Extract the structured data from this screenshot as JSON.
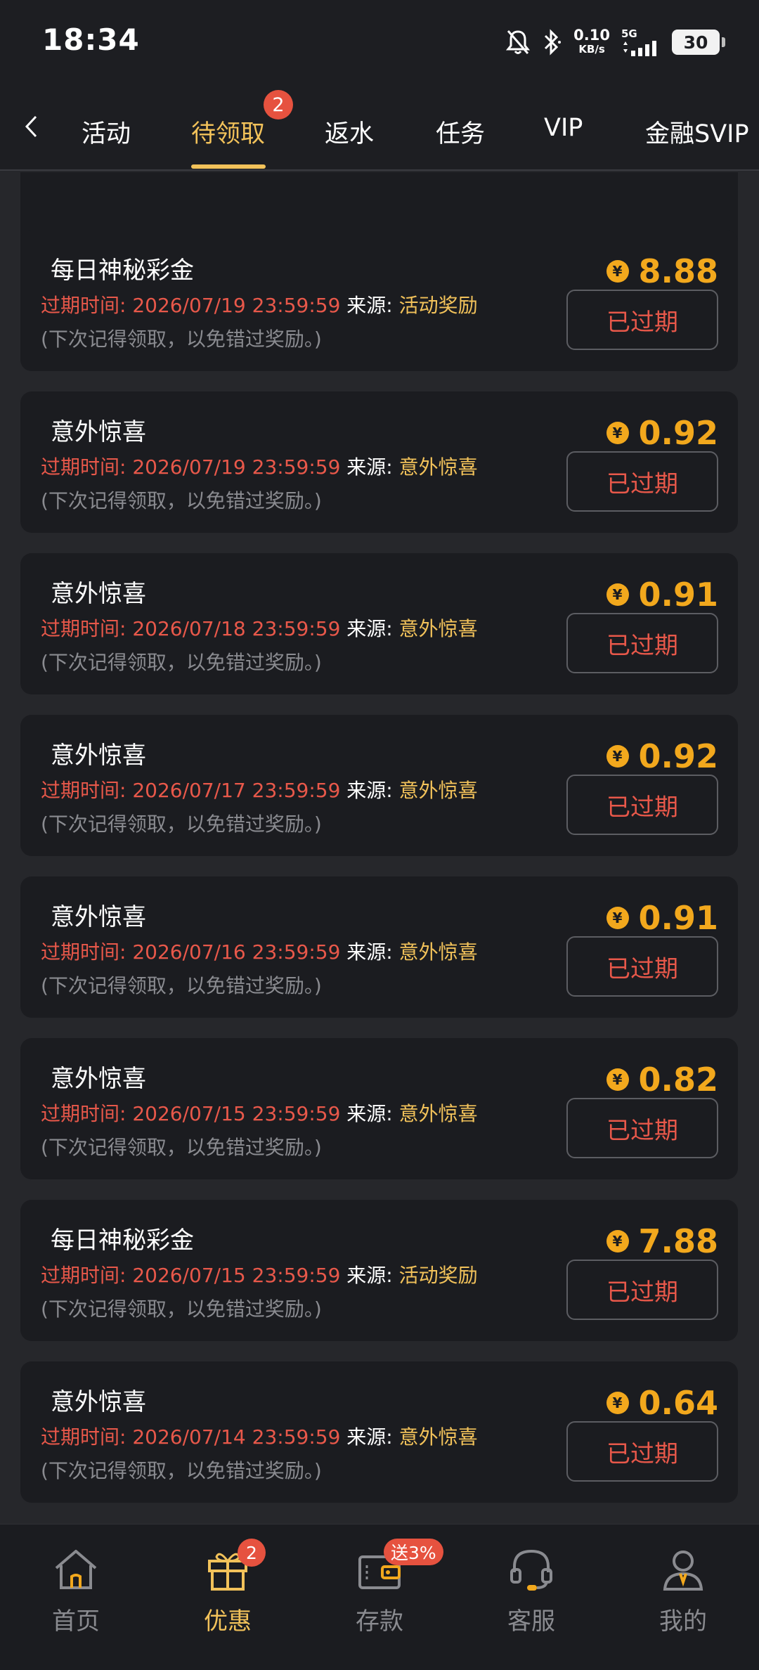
{
  "status_bar": {
    "time": "18:34",
    "net_speed_value": "0.10",
    "net_speed_unit": "KB/s",
    "signal_label": "5G",
    "battery": "30"
  },
  "tabs": [
    {
      "label": "活动"
    },
    {
      "label": "待领取",
      "badge": "2",
      "active": true
    },
    {
      "label": "返水"
    },
    {
      "label": "任务"
    },
    {
      "label": "VIP"
    },
    {
      "label": "金融SVIP"
    }
  ],
  "labels": {
    "expire_prefix": "过期时间:",
    "source_prefix": "来源:",
    "note": "(下次记得领取，以免错过奖励。)",
    "button": "已过期",
    "coin_symbol": "¥"
  },
  "cards": [
    {
      "title": "每日神秘彩金",
      "expire": "2026/07/19 23:59:59",
      "source": "活动奖励",
      "amount": "8.88"
    },
    {
      "title": "意外惊喜",
      "expire": "2026/07/19 23:59:59",
      "source": "意外惊喜",
      "amount": "0.92"
    },
    {
      "title": "意外惊喜",
      "expire": "2026/07/18 23:59:59",
      "source": "意外惊喜",
      "amount": "0.91"
    },
    {
      "title": "意外惊喜",
      "expire": "2026/07/17 23:59:59",
      "source": "意外惊喜",
      "amount": "0.92"
    },
    {
      "title": "意外惊喜",
      "expire": "2026/07/16 23:59:59",
      "source": "意外惊喜",
      "amount": "0.91"
    },
    {
      "title": "意外惊喜",
      "expire": "2026/07/15 23:59:59",
      "source": "意外惊喜",
      "amount": "0.82"
    },
    {
      "title": "每日神秘彩金",
      "expire": "2026/07/15 23:59:59",
      "source": "活动奖励",
      "amount": "7.88"
    },
    {
      "title": "意外惊喜",
      "expire": "2026/07/14 23:59:59",
      "source": "意外惊喜",
      "amount": "0.64"
    }
  ],
  "bottom_nav": [
    {
      "label": "首页",
      "icon": "home-icon"
    },
    {
      "label": "优惠",
      "icon": "gift-icon",
      "badge": "2",
      "active": true
    },
    {
      "label": "存款",
      "icon": "wallet-icon",
      "badge": "送3%"
    },
    {
      "label": "客服",
      "icon": "headset-icon"
    },
    {
      "label": "我的",
      "icon": "user-icon"
    }
  ],
  "colors": {
    "accent_gold": "#f2c25a",
    "amount_orange": "#f2a81d",
    "expired_red": "#e8584a",
    "badge_red": "#e6523f",
    "background": "#26272b",
    "card": "#1b1c20"
  }
}
